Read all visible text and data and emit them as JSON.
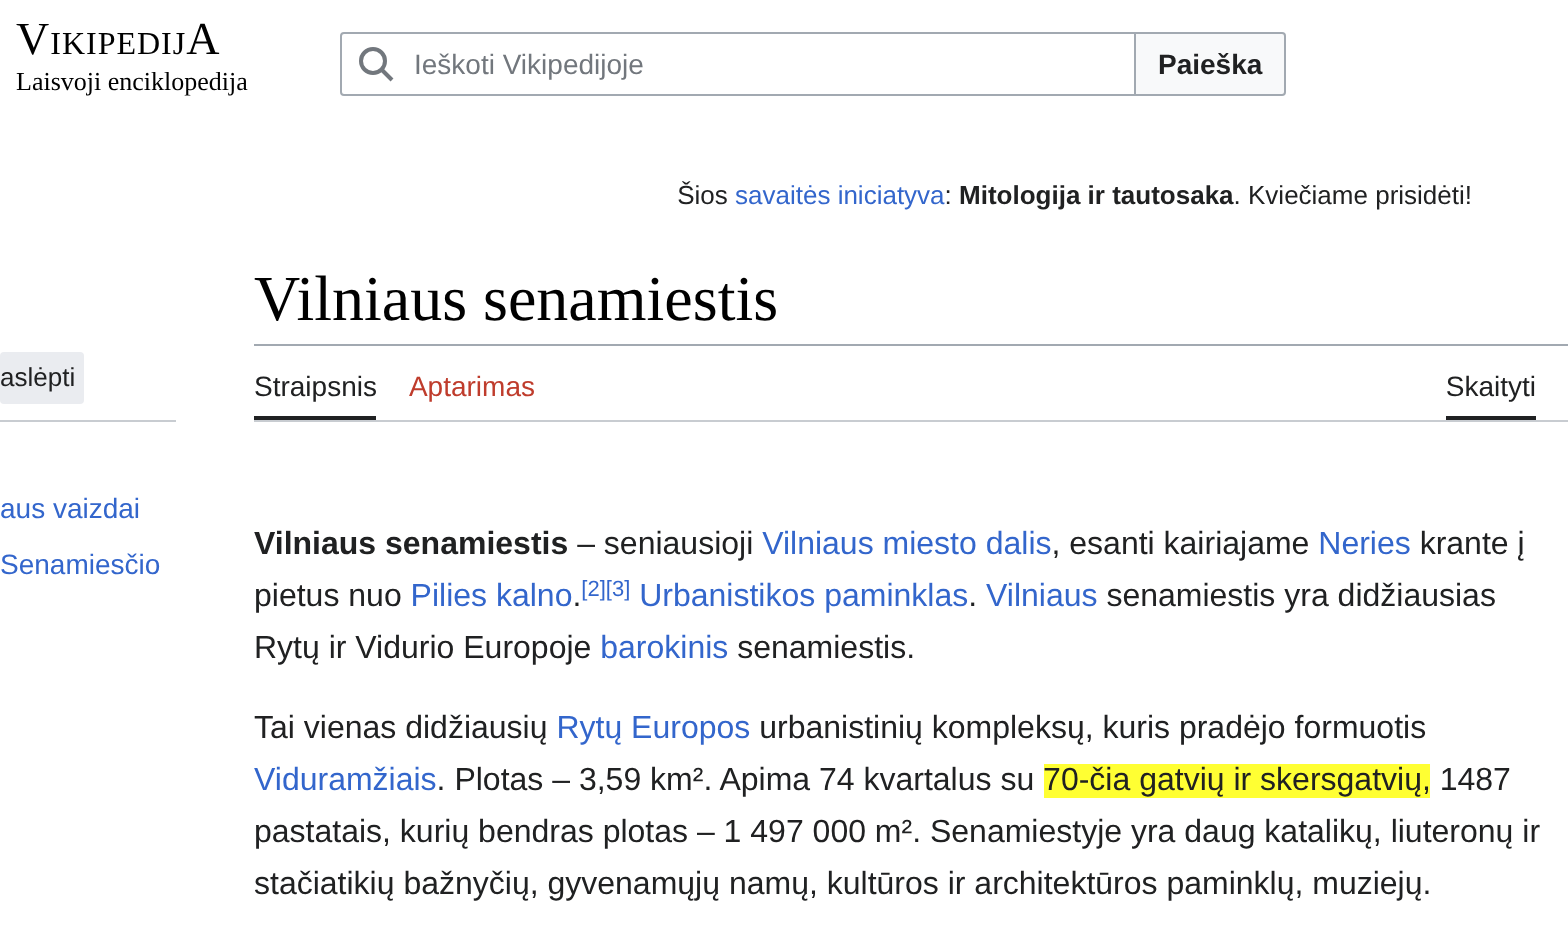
{
  "logo": {
    "wordmark": "VikipedijA",
    "tagline": "Laisvoji enciklopedija"
  },
  "search": {
    "placeholder": "Ieškoti Vikipedijoje",
    "button": "Paieška"
  },
  "notice": [
    {
      "kind": "text",
      "text": "Šios "
    },
    {
      "kind": "link",
      "text": "savaitės iniciatyva"
    },
    {
      "kind": "text",
      "text": ": "
    },
    {
      "kind": "bold",
      "text": "Mitologija ir tautosaka"
    },
    {
      "kind": "text",
      "text": ". Kviečiame prisidėti!"
    }
  ],
  "sidebar": {
    "hide_button": "aslėpti",
    "items": [
      "aus vaizdai",
      "Senamiesčio"
    ]
  },
  "title": "Vilniaus senamiestis",
  "tabs": [
    {
      "label": "Straipsnis",
      "selected": true,
      "kind": "plain"
    },
    {
      "label": "Aptarimas",
      "selected": false,
      "kind": "red"
    }
  ],
  "view_tabs": [
    {
      "label": "Skaityti",
      "selected": true
    }
  ],
  "paragraphs": [
    [
      {
        "kind": "bold",
        "text": "Vilniaus senamiestis"
      },
      {
        "kind": "text",
        "text": " – seniausioji "
      },
      {
        "kind": "link",
        "text": "Vilniaus miesto dalis"
      },
      {
        "kind": "text",
        "text": ", esanti kairiajame "
      },
      {
        "kind": "link",
        "text": "Neries"
      },
      {
        "kind": "text",
        "text": " krante į pietus nuo "
      },
      {
        "kind": "link",
        "text": "Pilies kalno"
      },
      {
        "kind": "text",
        "text": "."
      },
      {
        "kind": "ref",
        "text": "[2]"
      },
      {
        "kind": "ref",
        "text": "[3]"
      },
      {
        "kind": "link",
        "text": "Urbanistikos paminklas",
        "space_before": true
      },
      {
        "kind": "text",
        "text": ". "
      },
      {
        "kind": "link",
        "text": "Vilniaus"
      },
      {
        "kind": "text",
        "text": " senamiestis yra didžiausias Rytų ir Vidurio Europoje "
      },
      {
        "kind": "link",
        "text": "barokinis"
      },
      {
        "kind": "text",
        "text": " senamiestis."
      }
    ],
    [
      {
        "kind": "text",
        "text": "Tai vienas didžiausių "
      },
      {
        "kind": "link",
        "text": "Rytų Europos"
      },
      {
        "kind": "text",
        "text": " urbanistinių kompleksų, kuris pradėjo formuotis "
      },
      {
        "kind": "link",
        "text": "Viduramžiais"
      },
      {
        "kind": "text",
        "text": ". Plotas – 3,59 km². Apima 74 kvartalus su "
      },
      {
        "kind": "highlight",
        "text": "70-čia gatvių ir skersgatvių,"
      },
      {
        "kind": "text",
        "text": " 1487 pastatais, kurių bendras plotas – 1 497 000 m². Senamiestyje yra daug katalikų, liuteronų ir stačiatikių bažnyčių, gyvenamųjų namų, kultūros ir architektūros paminklų, muziejų."
      }
    ]
  ]
}
